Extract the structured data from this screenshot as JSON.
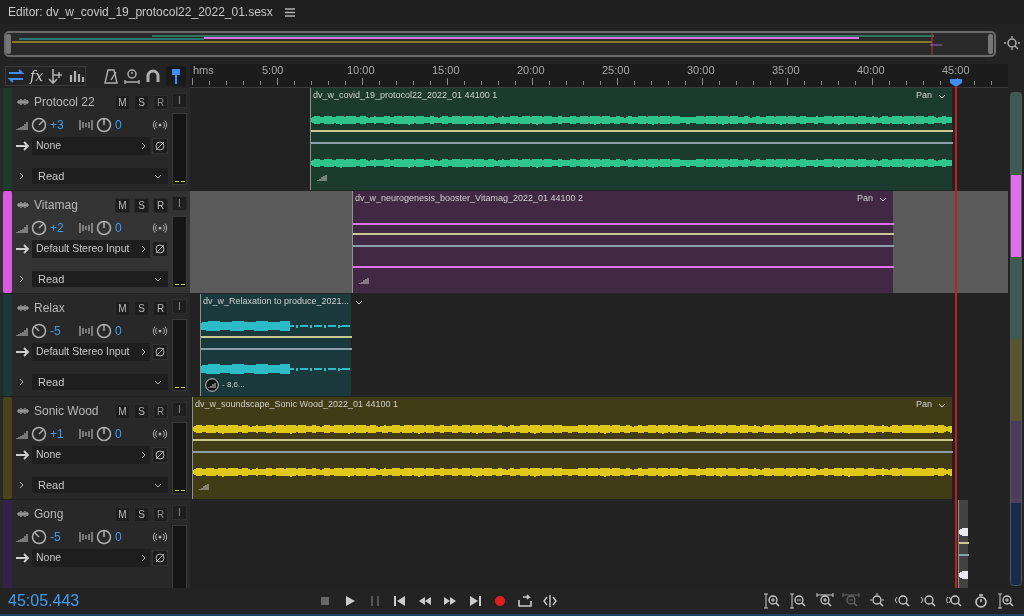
{
  "editor": {
    "title": "Editor: dv_w_covid_19_protocol22_2022_01.sesx"
  },
  "toolbar": {
    "effects_label": "fx"
  },
  "ruler": {
    "labels": [
      "hms",
      "5:00",
      "10:00",
      "15:00",
      "20:00",
      "25:00",
      "30:00",
      "35:00",
      "40:00",
      "45:00"
    ]
  },
  "tracks": [
    {
      "name": "Protocol 22",
      "color": "#1e3a2f",
      "selected": false,
      "volume": "+3",
      "pan": "0",
      "input": "None",
      "automation": "Read",
      "buttons": [
        {
          "label": "M",
          "disabled": false
        },
        {
          "label": "S",
          "disabled": false
        },
        {
          "label": "R",
          "disabled": true
        },
        {
          "label": "I",
          "disabled": true
        }
      ],
      "clip": {
        "name": "dv_w_covid_19_protocol22_2022_01 44100 1",
        "color": "#2ec48c",
        "kind": "steady",
        "pan_label": "Pan"
      }
    },
    {
      "name": "Vitamag",
      "color": "#d85ce0",
      "selected": true,
      "volume": "+2",
      "pan": "0",
      "input": "Default Stereo Input",
      "automation": "Read",
      "buttons": [
        {
          "label": "M",
          "disabled": false
        },
        {
          "label": "S",
          "disabled": false
        },
        {
          "label": "R",
          "disabled": false
        },
        {
          "label": "I",
          "disabled": true
        }
      ],
      "clip": {
        "name": "dv_w_neurogenesis_booster_Vitamag_2022_01 44100 2",
        "color": "#e070ea",
        "kind": "flat",
        "pan_label": "Pan"
      }
    },
    {
      "name": "Relax",
      "color": "#1b3a36",
      "selected": false,
      "volume": "-5",
      "pan": "0",
      "input": "Default Stereo Input",
      "automation": "Read",
      "buttons": [
        {
          "label": "M",
          "disabled": false
        },
        {
          "label": "S",
          "disabled": false
        },
        {
          "label": "R",
          "disabled": false
        },
        {
          "label": "I",
          "disabled": true
        }
      ],
      "clip": {
        "name": "dv_w_Relaxation to produce_2021...",
        "color": "#2bbcc8",
        "kind": "fading",
        "gain": "- 8,6..."
      }
    },
    {
      "name": "Sonic Wood",
      "color": "#4a4418",
      "selected": false,
      "volume": "+1",
      "pan": "0",
      "input": "None",
      "automation": "Read",
      "buttons": [
        {
          "label": "M",
          "disabled": false
        },
        {
          "label": "S",
          "disabled": false
        },
        {
          "label": "R",
          "disabled": true
        },
        {
          "label": "I",
          "disabled": true
        }
      ],
      "clip": {
        "name": "dv_w_soundscape_Sonic Wood_2022_01 44100 1",
        "color": "#e0c818",
        "kind": "steady",
        "pan_label": "Pan"
      }
    },
    {
      "name": "Gong",
      "color": "#35224a",
      "selected": false,
      "volume": "-5",
      "pan": "0",
      "input": "None",
      "buttons": [
        {
          "label": "M",
          "disabled": false
        },
        {
          "label": "S",
          "disabled": false
        },
        {
          "label": "R",
          "disabled": true
        },
        {
          "label": "I",
          "disabled": true
        }
      ],
      "clip": {
        "color": "#e8e8f0",
        "kind": "steady"
      }
    }
  ],
  "status": {
    "time": "45:05.443"
  }
}
